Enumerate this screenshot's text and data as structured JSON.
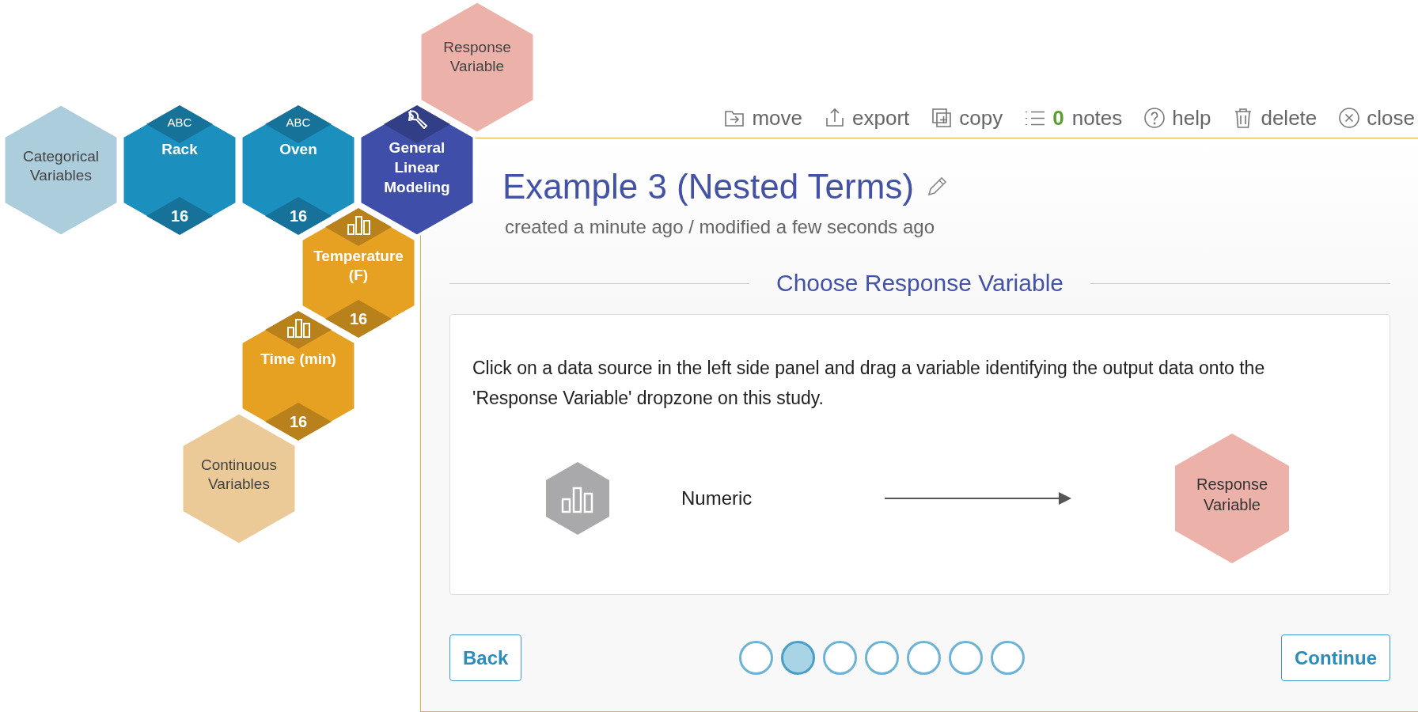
{
  "canvas": {
    "tiles": [
      {
        "kind": "dropzone",
        "label": "Response Variable",
        "color": "#ecb1a8"
      },
      {
        "kind": "group",
        "label": "Categorical Variables",
        "color": "#abcddc"
      },
      {
        "kind": "categorical",
        "type_label": "ABC",
        "label": "Rack",
        "count": "16",
        "color": "#1b8fbe"
      },
      {
        "kind": "categorical",
        "type_label": "ABC",
        "label": "Oven",
        "count": "16",
        "color": "#1b8fbe"
      },
      {
        "kind": "analysis",
        "label": "General Linear Modeling",
        "color": "#3f4ea8"
      },
      {
        "kind": "continuous",
        "label": "Temperature (F)",
        "count": "16",
        "color": "#e6a122"
      },
      {
        "kind": "continuous",
        "label": "Time (min)",
        "count": "16",
        "color": "#e6a122"
      },
      {
        "kind": "group",
        "label": "Continuous Variables",
        "color": "#ebca97"
      }
    ]
  },
  "toolbar": [
    {
      "kind": "move",
      "label": "move"
    },
    {
      "kind": "export",
      "label": "export"
    },
    {
      "kind": "copy",
      "label": "copy"
    },
    {
      "kind": "notes",
      "count": "0",
      "label": "notes"
    },
    {
      "kind": "help",
      "label": "help"
    },
    {
      "kind": "delete",
      "label": "delete"
    },
    {
      "kind": "close",
      "label": "close"
    }
  ],
  "study": {
    "title": "Example 3 (Nested Terms)",
    "meta": "created a minute ago / modified a few seconds ago",
    "section_title": "Choose Response Variable",
    "instructions": "Click on a data source in the left side panel and drag a variable identifying the output data onto the 'Response Variable' dropzone on this study.",
    "mapping": {
      "source_type": "Numeric",
      "target": "Response Variable",
      "color": "#ecb1a8"
    },
    "steps": [
      {
        "selected": false
      },
      {
        "selected": true
      },
      {
        "selected": false
      },
      {
        "selected": false
      },
      {
        "selected": false
      },
      {
        "selected": false
      },
      {
        "selected": false
      }
    ],
    "back": "Back",
    "continue": "Continue"
  }
}
